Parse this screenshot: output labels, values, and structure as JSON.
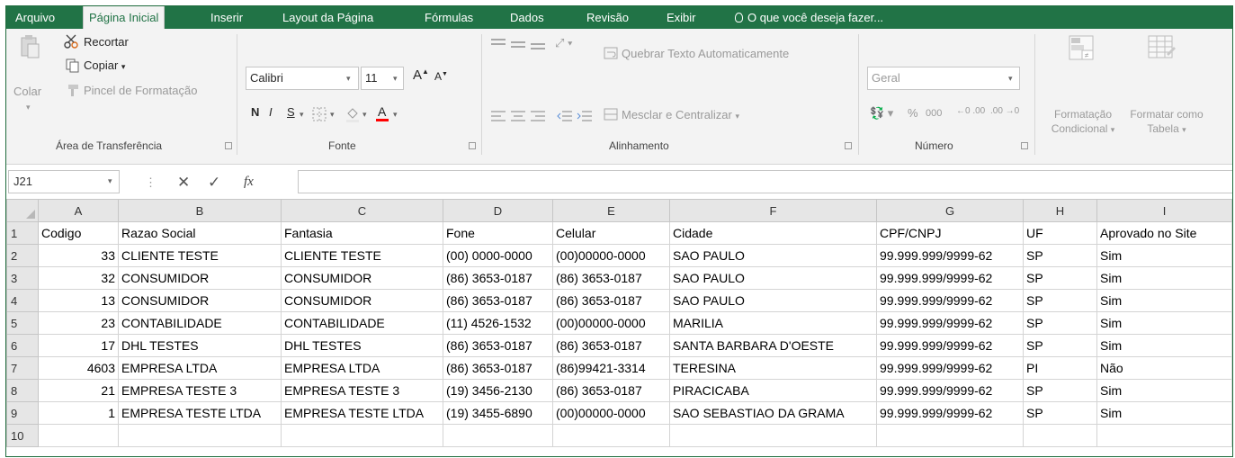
{
  "ribbon": {
    "tabs": [
      "Arquivo",
      "Página Inicial",
      "Inserir",
      "Layout da Página",
      "Fórmulas",
      "Dados",
      "Revisão",
      "Exibir"
    ],
    "tell_me": "O que você deseja fazer...",
    "clipboard": {
      "paste": "Colar",
      "cut": "Recortar",
      "copy": "Copiar",
      "format_painter": "Pincel de Formatação",
      "label": "Área de Transferência"
    },
    "font": {
      "name": "Calibri",
      "size": "11",
      "bold": "N",
      "italic": "I",
      "underline": "S",
      "label": "Fonte"
    },
    "alignment": {
      "wrap": "Quebrar Texto Automaticamente",
      "merge": "Mesclar e Centralizar",
      "label": "Alinhamento"
    },
    "number": {
      "format": "Geral",
      "percent": "%",
      "thousands": "000",
      "label": "Número"
    },
    "styles": {
      "conditional_1": "Formatação",
      "conditional_2": "Condicional",
      "table_1": "Formatar como",
      "table_2": "Tabela"
    }
  },
  "formula_bar": {
    "name_box": "J21",
    "fx": "fx",
    "value": ""
  },
  "sheet": {
    "columns": [
      "A",
      "B",
      "C",
      "D",
      "E",
      "F",
      "G",
      "H",
      "I"
    ],
    "row_numbers": [
      "1",
      "2",
      "3",
      "4",
      "5",
      "6",
      "7",
      "8",
      "9",
      "10"
    ],
    "rows": [
      [
        "Codigo",
        "Razao Social",
        "Fantasia",
        "Fone",
        "Celular",
        "Cidade",
        "CPF/CNPJ",
        "UF",
        "Aprovado no Site"
      ],
      [
        "33",
        "CLIENTE TESTE",
        "CLIENTE TESTE",
        "(00) 0000-0000",
        "(00)00000-0000",
        "SAO PAULO",
        "99.999.999/9999-62",
        "SP",
        "Sim"
      ],
      [
        "32",
        "CONSUMIDOR",
        "CONSUMIDOR",
        "(86) 3653-0187",
        "(86) 3653-0187",
        "SAO PAULO",
        "99.999.999/9999-62",
        "SP",
        "Sim"
      ],
      [
        "13",
        "CONSUMIDOR",
        "CONSUMIDOR",
        "(86) 3653-0187",
        "(86) 3653-0187",
        "SAO PAULO",
        "99.999.999/9999-62",
        "SP",
        "Sim"
      ],
      [
        "23",
        "CONTABILIDADE",
        "CONTABILIDADE",
        "(11) 4526-1532",
        "(00)00000-0000",
        "MARILIA",
        "99.999.999/9999-62",
        "SP",
        "Sim"
      ],
      [
        "17",
        "DHL TESTES",
        "DHL TESTES",
        "(86) 3653-0187",
        "(86) 3653-0187",
        "SANTA BARBARA D'OESTE",
        "99.999.999/9999-62",
        "SP",
        "Sim"
      ],
      [
        "4603",
        "EMPRESA LTDA",
        "EMPRESA LTDA",
        "(86) 3653-0187",
        "(86)99421-3314",
        "TERESINA",
        "99.999.999/9999-62",
        "PI",
        "Não"
      ],
      [
        "21",
        "EMPRESA TESTE 3",
        "EMPRESA TESTE 3",
        "(19) 3456-2130",
        "(86) 3653-0187",
        "PIRACICABA",
        "99.999.999/9999-62",
        "SP",
        "Sim"
      ],
      [
        "1",
        "EMPRESA TESTE LTDA",
        "EMPRESA TESTE LTDA",
        "(19) 3455-6890",
        "(00)00000-0000",
        "SAO SEBASTIAO DA GRAMA",
        "99.999.999/9999-62",
        "SP",
        "Sim"
      ],
      [
        "",
        "",
        "",
        "",
        "",
        "",
        "",
        "",
        ""
      ]
    ]
  },
  "colors": {
    "accent": "#217346",
    "ribbon_bg": "#f3f3f3",
    "header_bg": "#e6e6e6",
    "font_color_bar": "#ff0000"
  }
}
